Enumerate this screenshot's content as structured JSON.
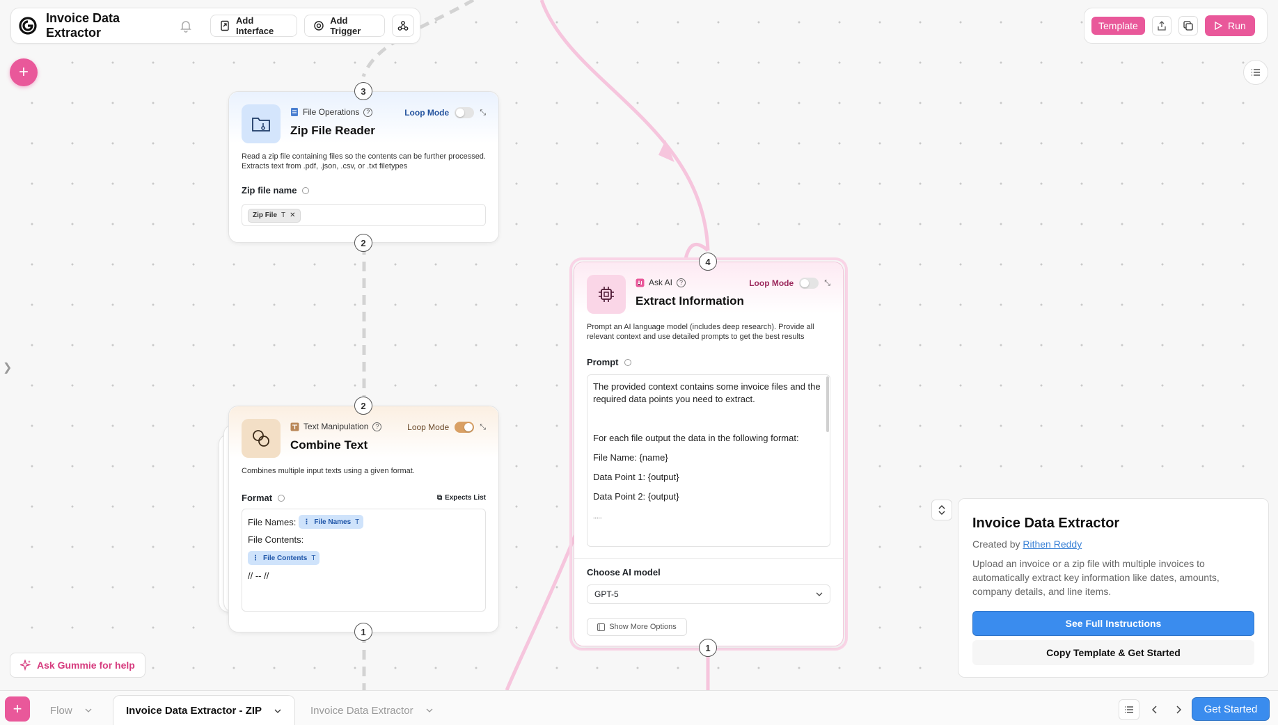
{
  "app": {
    "title": "Invoice Data Extractor",
    "add_interface": "Add Interface",
    "add_trigger": "Add Trigger"
  },
  "toolbar_right": {
    "template": "Template",
    "run": "Run"
  },
  "nodes": {
    "zip_reader": {
      "category": "File Operations",
      "title": "Zip File Reader",
      "loop_mode": "Loop Mode",
      "loop_on": false,
      "description": "Read a zip file containing files so the contents can be further processed. Extracts text from .pdf, .json, .csv, or .txt filetypes",
      "field_label": "Zip file name",
      "chip": "Zip File",
      "port_top": "3",
      "port_bottom": "2"
    },
    "combine_text": {
      "category": "Text Manipulation",
      "title": "Combine Text",
      "loop_mode": "Loop Mode",
      "loop_on": true,
      "description": "Combines multiple input texts using a given format.",
      "field_label": "Format",
      "expects_list": "Expects List",
      "line1_label": "File Names:",
      "chip1": "File Names",
      "line2_label": "File Contents:",
      "chip2": "File Contents",
      "line3": "// -- //",
      "port_top": "2",
      "port_bottom": "1"
    },
    "extract_info": {
      "category": "Ask AI",
      "title": "Extract Information",
      "loop_mode": "Loop Mode",
      "loop_on": false,
      "description": "Prompt an AI language model (includes deep research). Provide all relevant context and use detailed prompts to get the best results",
      "prompt_label": "Prompt",
      "prompt_lines": [
        "The provided context contains some invoice files and the required data points you need to extract.",
        "",
        "For each file output the data in the following format:",
        "File Name: {name}",
        "Data Point 1: {output}",
        "Data Point 2: {output}",
        "....."
      ],
      "model_label": "Choose AI model",
      "model_value": "GPT-5",
      "more_options": "Show More Options",
      "port_top": "4",
      "port_bottom": "1"
    }
  },
  "info_card": {
    "title": "Invoice Data Extractor",
    "created_by": "Created by",
    "author": "Rithen Reddy",
    "description": "Upload an invoice or a zip file with multiple invoices to automatically extract key information like dates, amounts, company details, and line items.",
    "see_instructions": "See Full Instructions",
    "copy_template": "Copy Template & Get Started"
  },
  "ask_gummie": "Ask Gummie for help",
  "bottom_tabs": {
    "flow": "Flow",
    "active": "Invoice Data Extractor - ZIP",
    "other": "Invoice Data Extractor"
  },
  "get_started": "Get Started",
  "colors": {
    "accent_pink": "#e9589a",
    "accent_blue": "#3a8cee",
    "ai_tint": "#fdeaf3",
    "file_tint": "#eaf2fe",
    "text_tint": "#fbefe2"
  }
}
